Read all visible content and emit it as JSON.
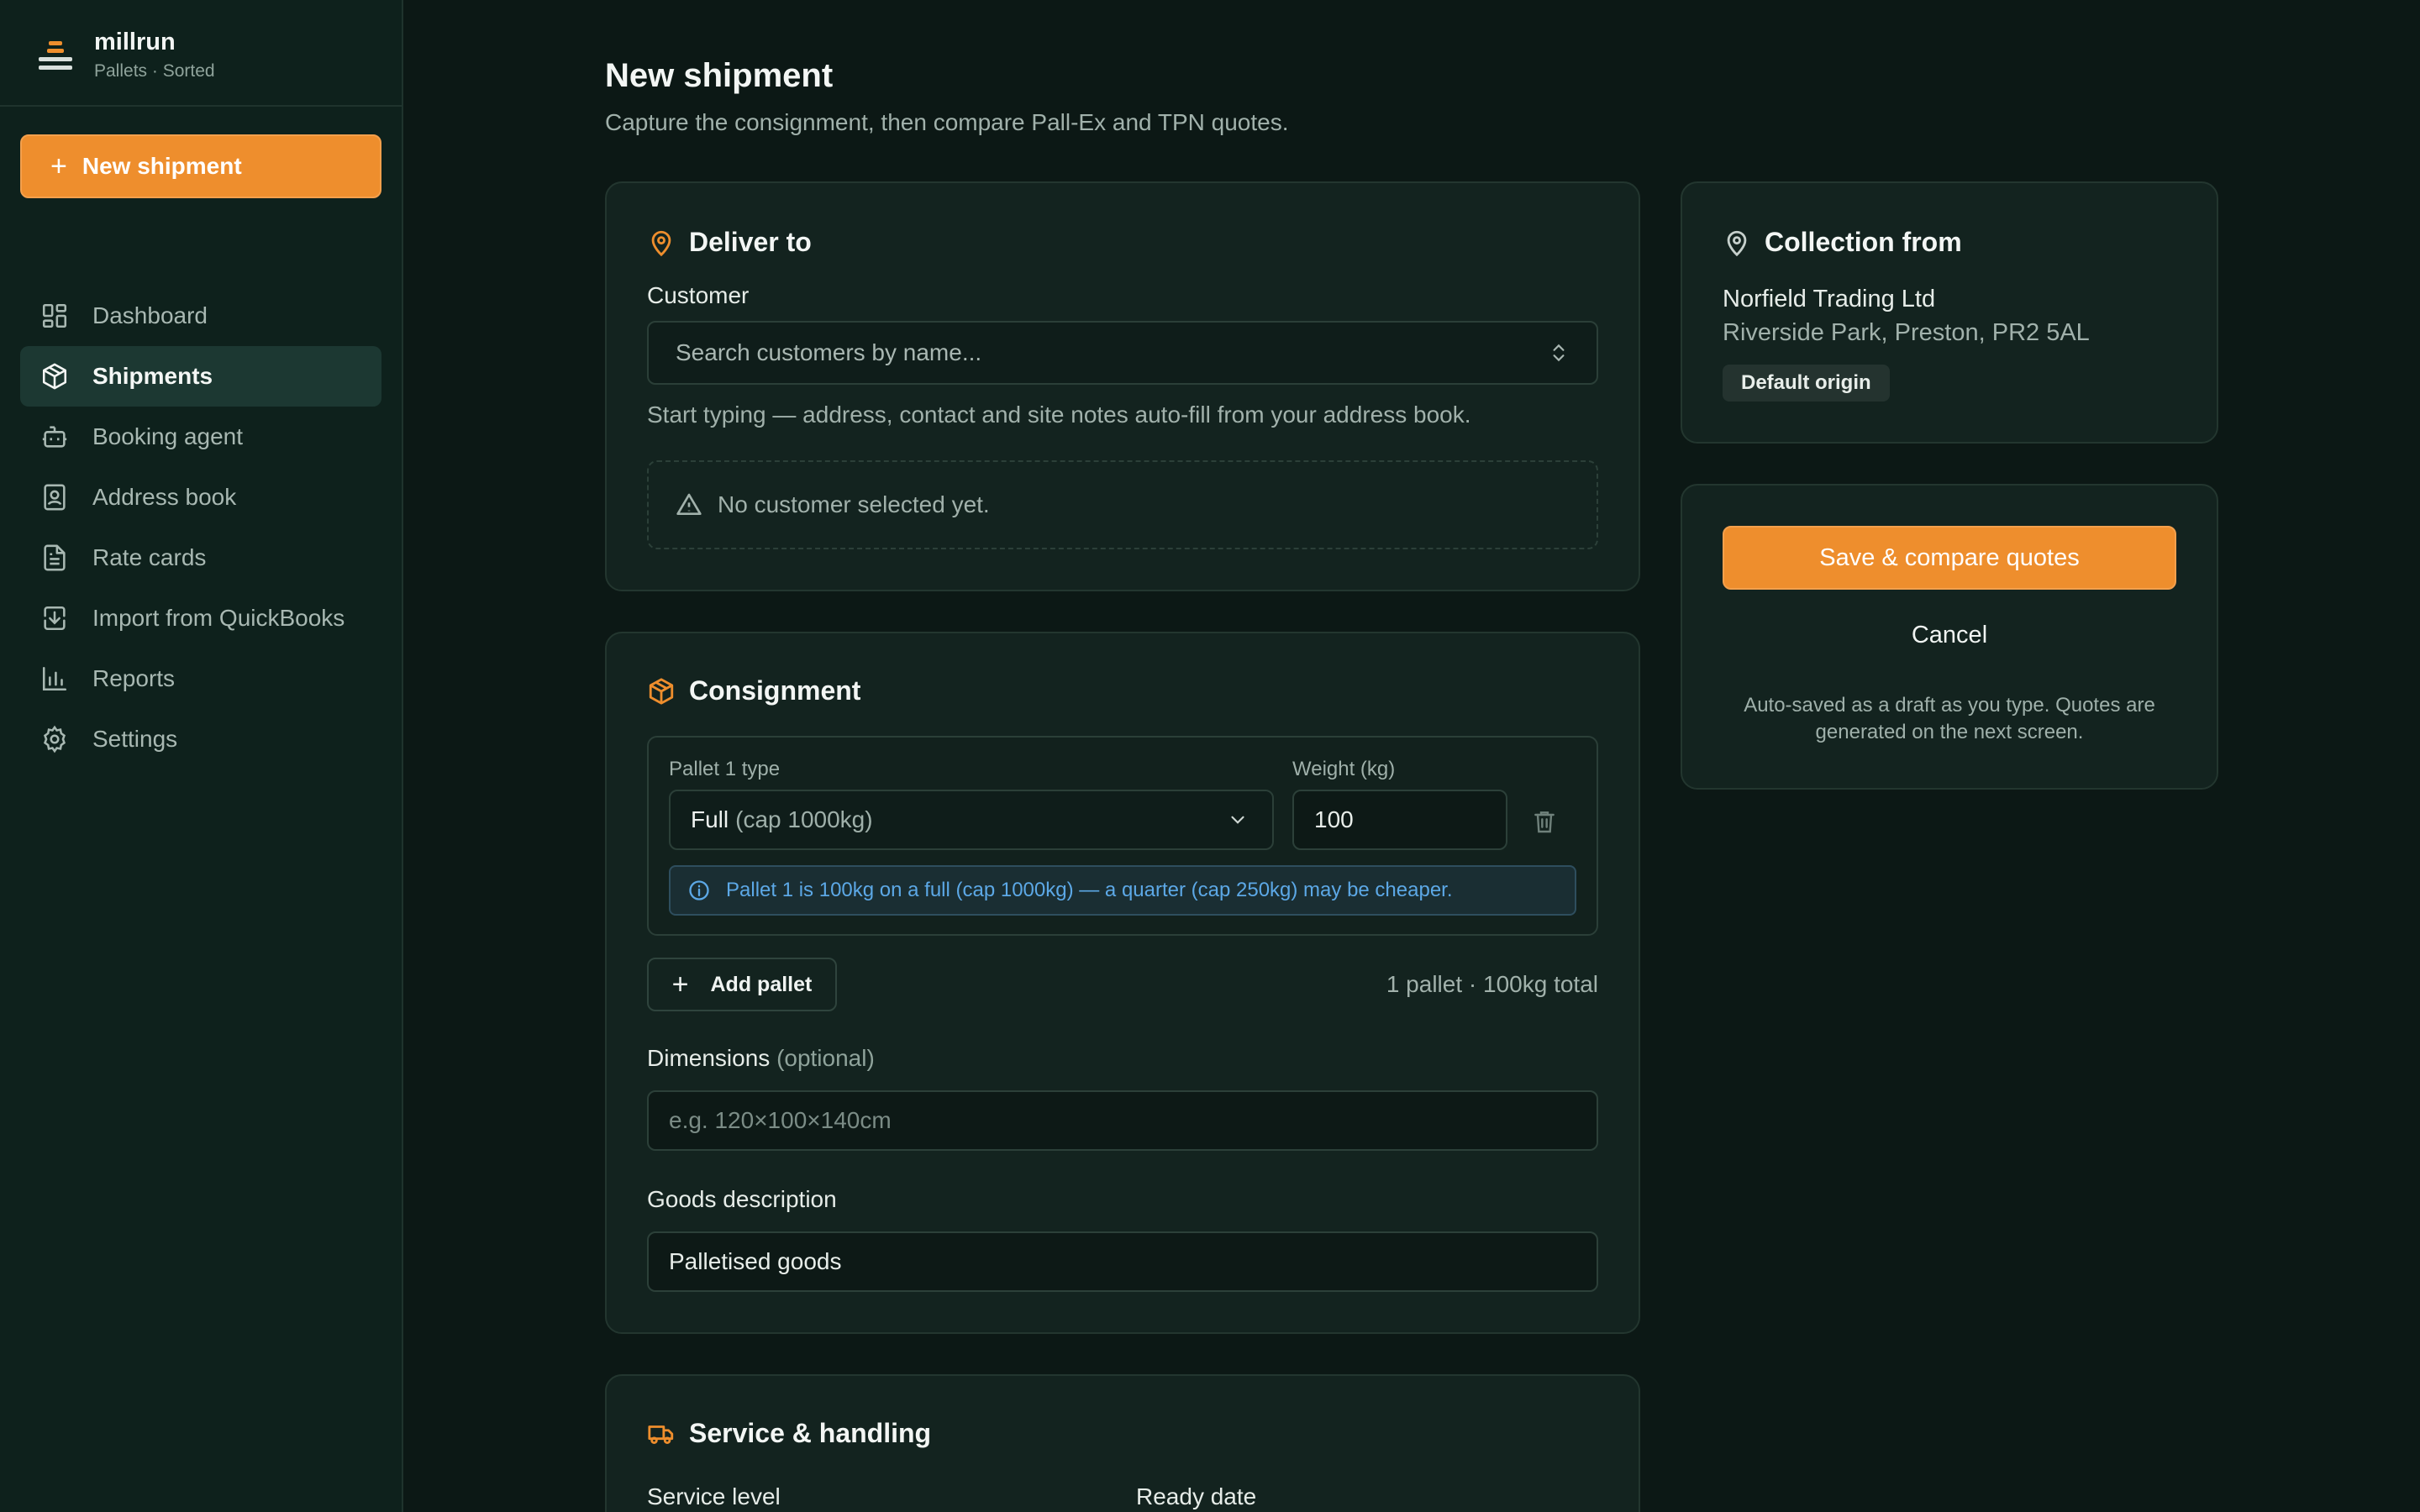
{
  "brand": {
    "name": "millrun",
    "tagline": "Pallets · Sorted"
  },
  "sidebar": {
    "new_button": "New shipment",
    "items": [
      {
        "label": "Dashboard",
        "icon": "dashboard-icon"
      },
      {
        "label": "Shipments",
        "icon": "package-icon",
        "active": true
      },
      {
        "label": "Booking agent",
        "icon": "bot-icon"
      },
      {
        "label": "Address book",
        "icon": "contact-book-icon"
      },
      {
        "label": "Rate cards",
        "icon": "document-icon"
      },
      {
        "label": "Import from QuickBooks",
        "icon": "import-icon"
      },
      {
        "label": "Reports",
        "icon": "bar-chart-icon"
      },
      {
        "label": "Settings",
        "icon": "gear-icon"
      }
    ]
  },
  "page": {
    "title": "New shipment",
    "subtitle": "Capture the consignment, then compare Pall-Ex and TPN quotes."
  },
  "deliver": {
    "title": "Deliver to",
    "customer_label": "Customer",
    "customer_placeholder": "Search customers by name...",
    "hint": "Start typing — address, contact and site notes auto-fill from your address book.",
    "empty": "No customer selected yet."
  },
  "consignment": {
    "title": "Consignment",
    "pallet_type_label": "Pallet 1 type",
    "pallet_type_value": "Full",
    "pallet_type_cap": "(cap 1000kg)",
    "weight_label": "Weight (kg)",
    "weight_value": "100",
    "info": "Pallet 1 is 100kg on a full (cap 1000kg) — a quarter (cap 250kg) may be cheaper.",
    "add_pallet": "Add pallet",
    "total": "1 pallet · 100kg total",
    "dimensions_label": "Dimensions",
    "dimensions_optional": "(optional)",
    "dimensions_placeholder": "e.g. 120×100×140cm",
    "goods_label": "Goods description",
    "goods_value": "Palletised goods"
  },
  "service": {
    "title": "Service & handling",
    "service_level_label": "Service level",
    "ready_date_label": "Ready date"
  },
  "collection": {
    "title": "Collection from",
    "name": "Norfield Trading Ltd",
    "address": "Riverside Park, Preston, PR2 5AL",
    "badge": "Default origin"
  },
  "actions": {
    "save": "Save & compare quotes",
    "cancel": "Cancel",
    "note": "Auto-saved as a draft as you type. Quotes are generated on the next screen."
  },
  "colors": {
    "accent": "#ee8e2d",
    "info": "#5ca8e6",
    "background": "#0c1815",
    "card": "#13231f"
  }
}
